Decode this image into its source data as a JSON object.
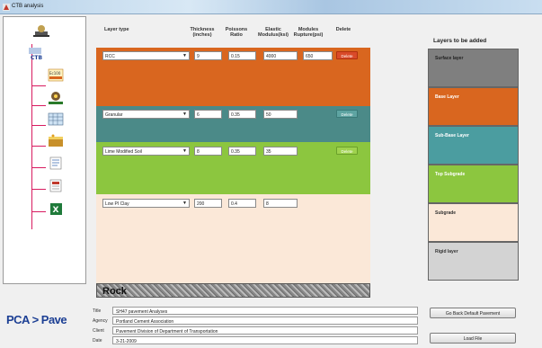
{
  "window": {
    "title": "CTB analysis"
  },
  "columns": {
    "layer_type": "Layer type",
    "thickness": "Thickness (inches)",
    "poissons": "Poissons Ratio",
    "elastic": "Elastic Modulus(ksi)",
    "rupture": "Modules Rupture(psi)",
    "delete": "Delete"
  },
  "layers": [
    {
      "type": "RCC",
      "thickness": "9",
      "poissons": "0.15",
      "elastic": "4000",
      "rupture": "650",
      "delete_label": "Delete",
      "color": "#d9661f"
    },
    {
      "type": "Granular",
      "thickness": "6",
      "poissons": "0.35",
      "elastic": "50",
      "delete_label": "Delete",
      "color": "#4b8a88"
    },
    {
      "type": "Lime Modified Soil",
      "thickness": "8",
      "poissons": "0.35",
      "elastic": "35",
      "delete_label": "Delete",
      "color": "#8cc63f"
    },
    {
      "type": "Low PI Clay",
      "thickness": "200",
      "poissons": "0.4",
      "elastic": "8",
      "color": "#fbe8d8"
    }
  ],
  "rock_label": "Rock",
  "project_info": {
    "title_label": "Title",
    "title_value": "SH47 pavement Analyses",
    "agency_label": "Agency",
    "agency_value": "Portland Cement Association",
    "client_label": "Client",
    "client_value": "Pavement Division of Department of Transportation",
    "date_label": "Date",
    "date_value": "3-21-2009"
  },
  "layers_to_add": {
    "title": "Layers to be added",
    "items": [
      {
        "label": "Surface layer",
        "color": "#7f7f7f",
        "text_color": "#222"
      },
      {
        "label": "Base Layer",
        "color": "#d9661f",
        "text_color": "#ffffff"
      },
      {
        "label": "Sub-Base Layer",
        "color": "#4b9da0",
        "text_color": "#ffffff"
      },
      {
        "label": "Top Subgrade",
        "color": "#8cc63f",
        "text_color": "#ffffff"
      },
      {
        "label": "Subgrade",
        "color": "#fbe8d8",
        "text_color": "#333"
      },
      {
        "label": "Rigid layer",
        "color": "#d3d3d3",
        "text_color": "#333"
      }
    ]
  },
  "buttons": {
    "default_pavement": "Go Back Default Pavement",
    "load_file": "Load File"
  },
  "logo": {
    "text": "PCA > Pave"
  },
  "tree_icons": [
    "boring-rig-icon",
    "ctb-icon",
    "ec100-icon",
    "sensor-icon",
    "grid-icon",
    "soil-icon",
    "document-icon",
    "chart-doc-icon",
    "excel-icon"
  ]
}
